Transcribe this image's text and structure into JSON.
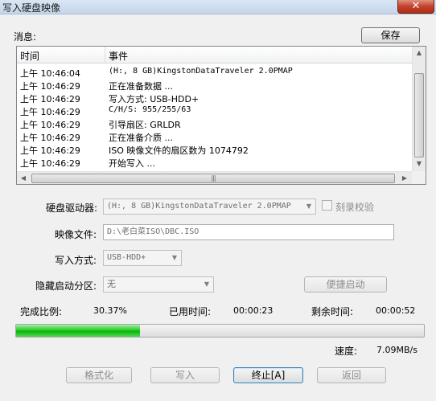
{
  "window": {
    "title": "写入硬盘映像",
    "close_glyph": "✕"
  },
  "messages_label": "消息:",
  "save_button": "保存",
  "log": {
    "columns": {
      "time": "时间",
      "event": "事件"
    },
    "rows": [
      {
        "time": "上午 10:46:04",
        "event": "(H:, 8 GB)KingstonDataTraveler 2.0PMAP"
      },
      {
        "time": "上午 10:46:29",
        "event": "正在准备数据 ..."
      },
      {
        "time": "上午 10:46:29",
        "event": "写入方式: USB-HDD+"
      },
      {
        "time": "上午 10:46:29",
        "event": "C/H/S: 955/255/63"
      },
      {
        "time": "上午 10:46:29",
        "event": "引导扇区: GRLDR"
      },
      {
        "time": "上午 10:46:29",
        "event": "正在准备介质 ..."
      },
      {
        "time": "上午 10:46:29",
        "event": "ISO 映像文件的扇区数为 1074792"
      },
      {
        "time": "上午 10:46:29",
        "event": "开始写入 ..."
      }
    ]
  },
  "form": {
    "drive_label": "硬盘驱动器:",
    "drive_value": "(H:, 8 GB)KingstonDataTraveler 2.0PMAP",
    "verify_label": "刻录校验",
    "image_label": "映像文件:",
    "image_value": "D:\\老白菜ISO\\DBC.ISO",
    "write_mode_label": "写入方式:",
    "write_mode_value": "USB-HDD+",
    "hidden_partition_label": "隐藏启动分区:",
    "hidden_partition_value": "无",
    "quick_boot_button": "便捷启动"
  },
  "status": {
    "percent_label": "完成比例:",
    "percent_value": "30.37%",
    "elapsed_label": "已用时间:",
    "elapsed_value": "00:00:23",
    "remaining_label": "剩余时间:",
    "remaining_value": "00:00:52",
    "speed_label": "速度:",
    "speed_value": "7.09MB/s"
  },
  "progress": {
    "fraction": 0.3037,
    "color": "#1ec41e"
  },
  "buttons": {
    "format": "格式化",
    "write": "写入",
    "stop": "终止[A]",
    "back": "返回"
  },
  "icons": {
    "scroll_up": "▲",
    "scroll_down": "▼",
    "scroll_left": "◀",
    "scroll_right": "▶",
    "combo_arrow": "▼",
    "thumb_grip": "|||"
  }
}
